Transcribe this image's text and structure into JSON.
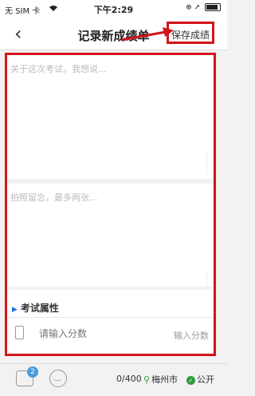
{
  "status_bar": {
    "carrier": "无 SIM 卡",
    "time": "下午2:29",
    "right_icons": "⊕ ➚"
  },
  "nav": {
    "back_icon": "chevron-left",
    "title": "记录新成绩单",
    "save_label": "保存成绩"
  },
  "comment": {
    "placeholder": "关于这次考试，我想说..."
  },
  "photos": {
    "placeholder": "拍照留念，最多两张..."
  },
  "section": {
    "title": "考试属性"
  },
  "score": {
    "placeholder": "请输入分数",
    "unit": "输入分数"
  },
  "bottom": {
    "badge": "2",
    "char_count": "0/400",
    "location": "梅州市",
    "visibility": "公开"
  },
  "colors": {
    "highlight": "#d4141b",
    "accent": "#1a73e8",
    "green": "#2e9b3b"
  }
}
